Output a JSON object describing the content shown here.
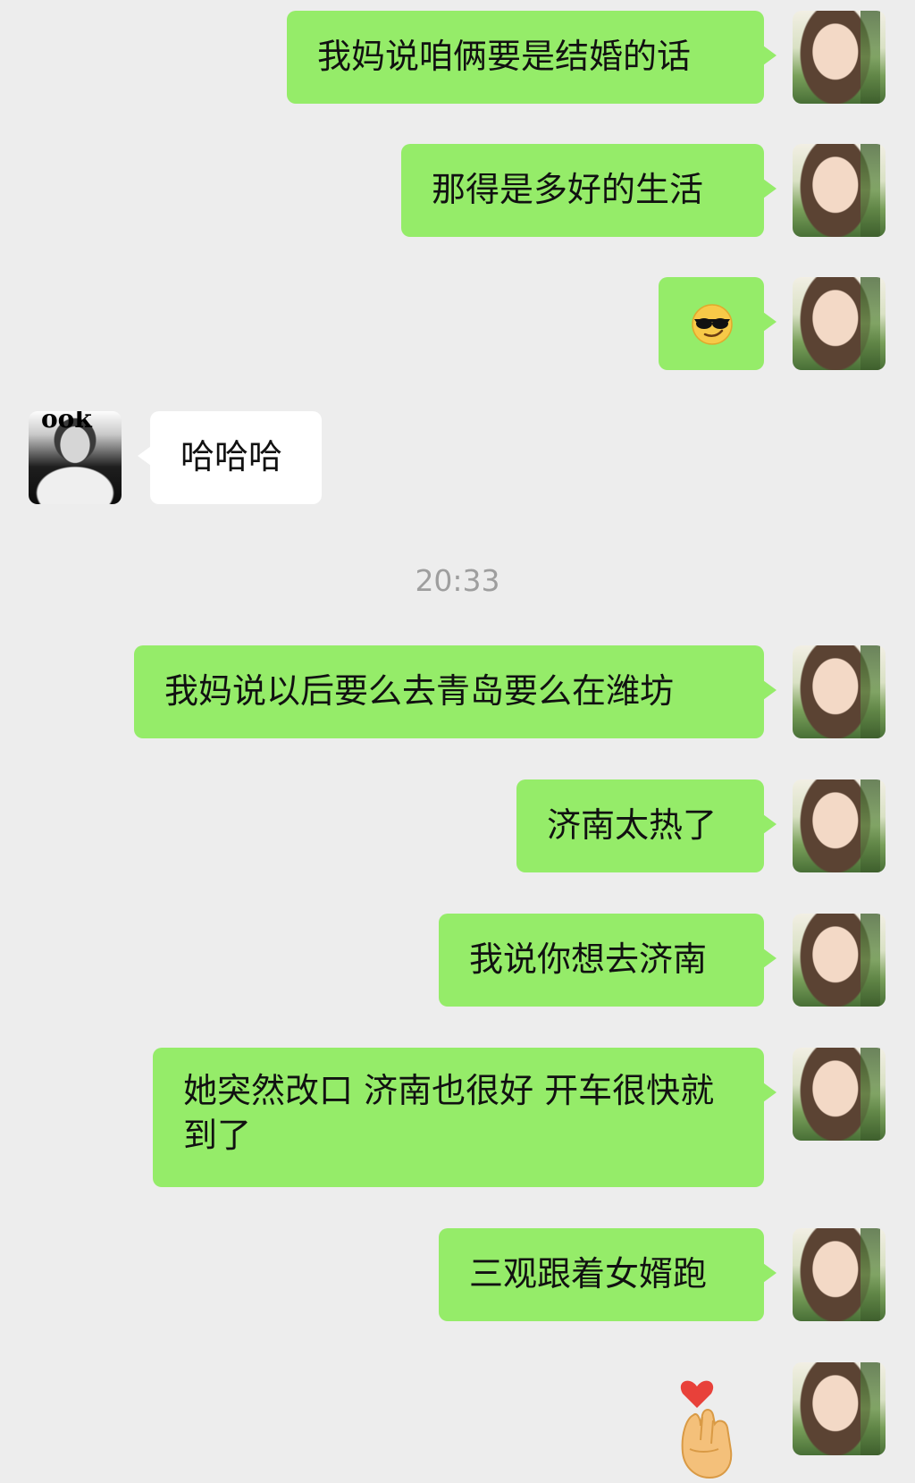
{
  "chat": {
    "timestamp": "20:33",
    "messages": [
      {
        "from": "me",
        "text": "我妈说咱俩要是结婚的话"
      },
      {
        "from": "me",
        "text": "那得是多好的生活"
      },
      {
        "from": "me",
        "emoji": "smiling-face-with-sunglasses"
      },
      {
        "from": "other",
        "text": "哈哈哈"
      },
      {
        "from": "me",
        "text": "我妈说以后要么去青岛要么在潍坊"
      },
      {
        "from": "me",
        "text": "济南太热了"
      },
      {
        "from": "me",
        "text": "我说你想去济南"
      },
      {
        "from": "me",
        "text": "她突然改口 济南也很好 开车很快就到了"
      },
      {
        "from": "me",
        "text": "三观跟着女婿跑"
      },
      {
        "from": "me",
        "emoji": "finger-heart"
      }
    ]
  },
  "colors": {
    "background": "#ededed",
    "my_bubble": "#95ec69",
    "other_bubble": "#ffffff",
    "timestamp_text": "#9e9e9e"
  }
}
